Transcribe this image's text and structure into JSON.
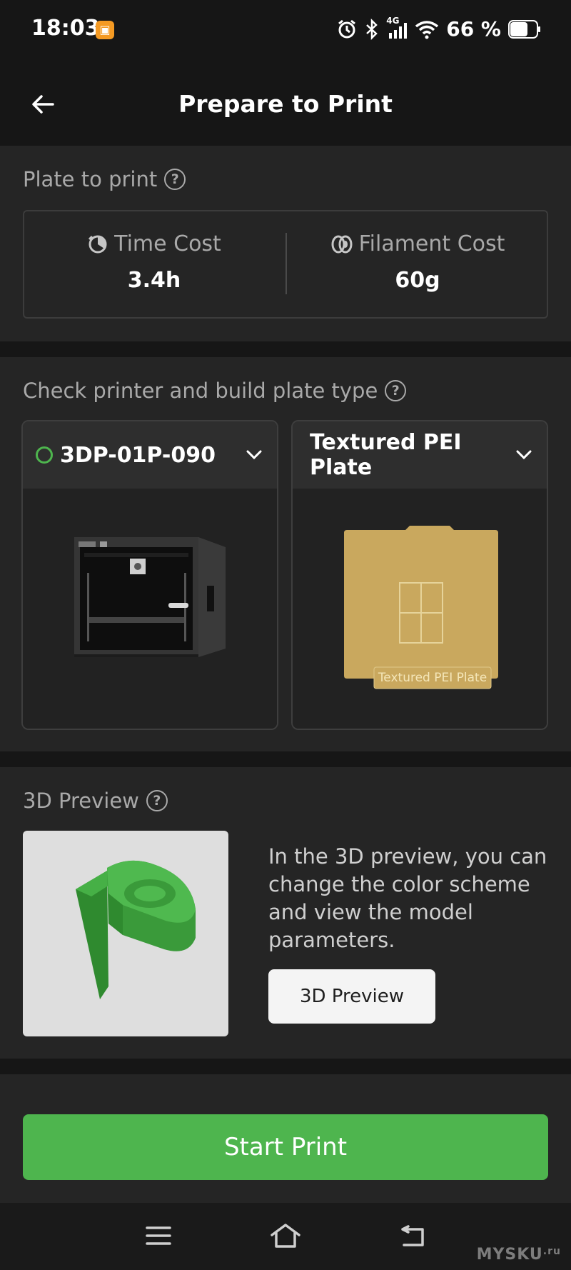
{
  "status_bar": {
    "time": "18:03",
    "app_icon": "app-notification-icon",
    "network": "4G",
    "battery_percent": "66 %",
    "battery_level": 0.66,
    "icons": [
      "alarm-icon",
      "bluetooth-icon",
      "signal-icon",
      "wifi-icon",
      "battery-icon"
    ]
  },
  "header": {
    "title": "Prepare to Print",
    "back_icon": "back-arrow-icon"
  },
  "plate_section": {
    "title": "Plate to print",
    "time_cost": {
      "label": "Time Cost",
      "value": "3.4h",
      "icon": "clock-icon"
    },
    "filament_cost": {
      "label": "Filament Cost",
      "value": "60g",
      "icon": "filament-spool-icon"
    }
  },
  "printer_section": {
    "title": "Check printer and build plate type",
    "printer": {
      "name": "3DP-01P-090",
      "status_color": "#4eb54e",
      "image": "printer-image"
    },
    "plate": {
      "name": "Textured PEI Plate",
      "image_label": "Textured PEI Plate"
    }
  },
  "preview_section": {
    "title": "3D Preview",
    "description": "In the 3D preview, you can change the color scheme and view the model parameters.",
    "button_label": "3D Preview",
    "model_color": "#3a9a3a"
  },
  "actions": {
    "start_print_label": "Start Print",
    "accent_color": "#4eb54e"
  },
  "nav_bar": {
    "icons": [
      "menu-icon",
      "home-icon",
      "back-icon"
    ]
  },
  "watermark": "MYSKU",
  "watermark_suffix": ".ru"
}
